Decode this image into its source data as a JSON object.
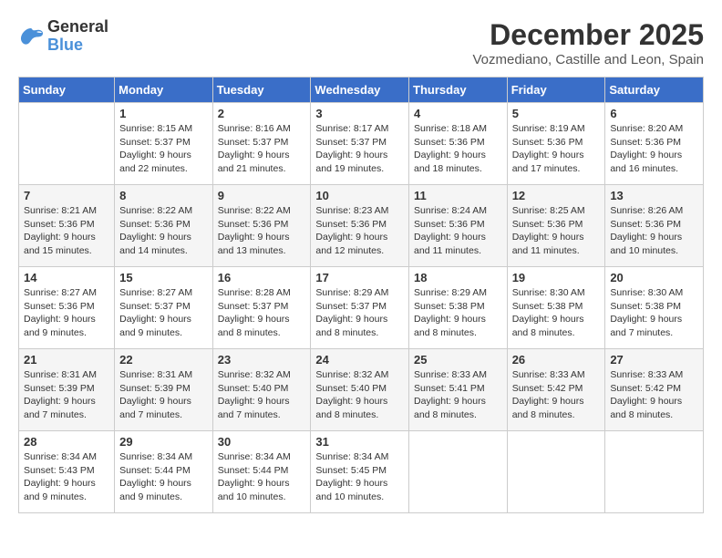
{
  "header": {
    "logo_line1": "General",
    "logo_line2": "Blue",
    "month": "December 2025",
    "location": "Vozmediano, Castille and Leon, Spain"
  },
  "days_of_week": [
    "Sunday",
    "Monday",
    "Tuesday",
    "Wednesday",
    "Thursday",
    "Friday",
    "Saturday"
  ],
  "weeks": [
    [
      {
        "day": "",
        "sunrise": "",
        "sunset": "",
        "daylight": ""
      },
      {
        "day": "1",
        "sunrise": "Sunrise: 8:15 AM",
        "sunset": "Sunset: 5:37 PM",
        "daylight": "Daylight: 9 hours and 22 minutes."
      },
      {
        "day": "2",
        "sunrise": "Sunrise: 8:16 AM",
        "sunset": "Sunset: 5:37 PM",
        "daylight": "Daylight: 9 hours and 21 minutes."
      },
      {
        "day": "3",
        "sunrise": "Sunrise: 8:17 AM",
        "sunset": "Sunset: 5:37 PM",
        "daylight": "Daylight: 9 hours and 19 minutes."
      },
      {
        "day": "4",
        "sunrise": "Sunrise: 8:18 AM",
        "sunset": "Sunset: 5:36 PM",
        "daylight": "Daylight: 9 hours and 18 minutes."
      },
      {
        "day": "5",
        "sunrise": "Sunrise: 8:19 AM",
        "sunset": "Sunset: 5:36 PM",
        "daylight": "Daylight: 9 hours and 17 minutes."
      },
      {
        "day": "6",
        "sunrise": "Sunrise: 8:20 AM",
        "sunset": "Sunset: 5:36 PM",
        "daylight": "Daylight: 9 hours and 16 minutes."
      }
    ],
    [
      {
        "day": "7",
        "sunrise": "Sunrise: 8:21 AM",
        "sunset": "Sunset: 5:36 PM",
        "daylight": "Daylight: 9 hours and 15 minutes."
      },
      {
        "day": "8",
        "sunrise": "Sunrise: 8:22 AM",
        "sunset": "Sunset: 5:36 PM",
        "daylight": "Daylight: 9 hours and 14 minutes."
      },
      {
        "day": "9",
        "sunrise": "Sunrise: 8:22 AM",
        "sunset": "Sunset: 5:36 PM",
        "daylight": "Daylight: 9 hours and 13 minutes."
      },
      {
        "day": "10",
        "sunrise": "Sunrise: 8:23 AM",
        "sunset": "Sunset: 5:36 PM",
        "daylight": "Daylight: 9 hours and 12 minutes."
      },
      {
        "day": "11",
        "sunrise": "Sunrise: 8:24 AM",
        "sunset": "Sunset: 5:36 PM",
        "daylight": "Daylight: 9 hours and 11 minutes."
      },
      {
        "day": "12",
        "sunrise": "Sunrise: 8:25 AM",
        "sunset": "Sunset: 5:36 PM",
        "daylight": "Daylight: 9 hours and 11 minutes."
      },
      {
        "day": "13",
        "sunrise": "Sunrise: 8:26 AM",
        "sunset": "Sunset: 5:36 PM",
        "daylight": "Daylight: 9 hours and 10 minutes."
      }
    ],
    [
      {
        "day": "14",
        "sunrise": "Sunrise: 8:27 AM",
        "sunset": "Sunset: 5:36 PM",
        "daylight": "Daylight: 9 hours and 9 minutes."
      },
      {
        "day": "15",
        "sunrise": "Sunrise: 8:27 AM",
        "sunset": "Sunset: 5:37 PM",
        "daylight": "Daylight: 9 hours and 9 minutes."
      },
      {
        "day": "16",
        "sunrise": "Sunrise: 8:28 AM",
        "sunset": "Sunset: 5:37 PM",
        "daylight": "Daylight: 9 hours and 8 minutes."
      },
      {
        "day": "17",
        "sunrise": "Sunrise: 8:29 AM",
        "sunset": "Sunset: 5:37 PM",
        "daylight": "Daylight: 9 hours and 8 minutes."
      },
      {
        "day": "18",
        "sunrise": "Sunrise: 8:29 AM",
        "sunset": "Sunset: 5:38 PM",
        "daylight": "Daylight: 9 hours and 8 minutes."
      },
      {
        "day": "19",
        "sunrise": "Sunrise: 8:30 AM",
        "sunset": "Sunset: 5:38 PM",
        "daylight": "Daylight: 9 hours and 8 minutes."
      },
      {
        "day": "20",
        "sunrise": "Sunrise: 8:30 AM",
        "sunset": "Sunset: 5:38 PM",
        "daylight": "Daylight: 9 hours and 7 minutes."
      }
    ],
    [
      {
        "day": "21",
        "sunrise": "Sunrise: 8:31 AM",
        "sunset": "Sunset: 5:39 PM",
        "daylight": "Daylight: 9 hours and 7 minutes."
      },
      {
        "day": "22",
        "sunrise": "Sunrise: 8:31 AM",
        "sunset": "Sunset: 5:39 PM",
        "daylight": "Daylight: 9 hours and 7 minutes."
      },
      {
        "day": "23",
        "sunrise": "Sunrise: 8:32 AM",
        "sunset": "Sunset: 5:40 PM",
        "daylight": "Daylight: 9 hours and 7 minutes."
      },
      {
        "day": "24",
        "sunrise": "Sunrise: 8:32 AM",
        "sunset": "Sunset: 5:40 PM",
        "daylight": "Daylight: 9 hours and 8 minutes."
      },
      {
        "day": "25",
        "sunrise": "Sunrise: 8:33 AM",
        "sunset": "Sunset: 5:41 PM",
        "daylight": "Daylight: 9 hours and 8 minutes."
      },
      {
        "day": "26",
        "sunrise": "Sunrise: 8:33 AM",
        "sunset": "Sunset: 5:42 PM",
        "daylight": "Daylight: 9 hours and 8 minutes."
      },
      {
        "day": "27",
        "sunrise": "Sunrise: 8:33 AM",
        "sunset": "Sunset: 5:42 PM",
        "daylight": "Daylight: 9 hours and 8 minutes."
      }
    ],
    [
      {
        "day": "28",
        "sunrise": "Sunrise: 8:34 AM",
        "sunset": "Sunset: 5:43 PM",
        "daylight": "Daylight: 9 hours and 9 minutes."
      },
      {
        "day": "29",
        "sunrise": "Sunrise: 8:34 AM",
        "sunset": "Sunset: 5:44 PM",
        "daylight": "Daylight: 9 hours and 9 minutes."
      },
      {
        "day": "30",
        "sunrise": "Sunrise: 8:34 AM",
        "sunset": "Sunset: 5:44 PM",
        "daylight": "Daylight: 9 hours and 10 minutes."
      },
      {
        "day": "31",
        "sunrise": "Sunrise: 8:34 AM",
        "sunset": "Sunset: 5:45 PM",
        "daylight": "Daylight: 9 hours and 10 minutes."
      },
      {
        "day": "",
        "sunrise": "",
        "sunset": "",
        "daylight": ""
      },
      {
        "day": "",
        "sunrise": "",
        "sunset": "",
        "daylight": ""
      },
      {
        "day": "",
        "sunrise": "",
        "sunset": "",
        "daylight": ""
      }
    ]
  ]
}
